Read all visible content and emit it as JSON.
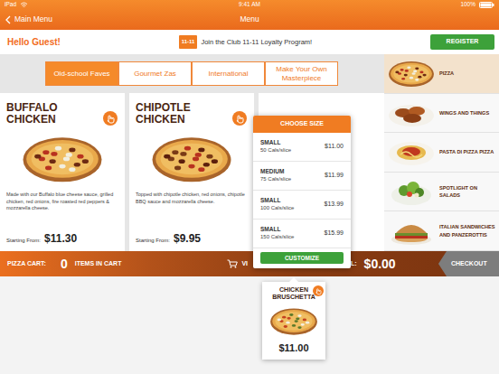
{
  "status_bar": {
    "carrier": "iPad",
    "time": "9:41 AM",
    "battery": "100%",
    "battery_level": 1
  },
  "nav_bar": {
    "back": "Main Menu",
    "title": "Menu"
  },
  "greeting": "Hello Guest!",
  "loyalty": {
    "logo": "11-11",
    "text": "Join the Club 11-11 Loyalty Program!"
  },
  "register_button": "REGISTER",
  "tabs": [
    {
      "label": "Old-school Faves",
      "selected": true
    },
    {
      "label": "Gourmet Zas",
      "selected": false
    },
    {
      "label": "International",
      "selected": false
    },
    {
      "label": "Make Your Own Masterpiece",
      "selected": false
    }
  ],
  "menu_items": [
    {
      "name": "BUFFALO CHICKEN",
      "description": "Made with our Buffalo blue cheese sauce, grilled chicken, red onions, fire roasted red peppers & mozzarella cheese.",
      "price_label": "Starting From:",
      "price": "$11.30"
    },
    {
      "name": "CHIPOTLE CHICKEN",
      "description": "Topped with chipotle chicken, red onions, chipotle BBQ sauce and mozzarella cheese.",
      "price_label": "Starting From:",
      "price": "$9.95"
    }
  ],
  "categories": [
    {
      "label": "PIZZA",
      "selected": true,
      "kind": "pizza"
    },
    {
      "label": "WINGS AND THINGS",
      "selected": false,
      "kind": "wings"
    },
    {
      "label": "PASTA DI PIZZA PIZZA",
      "selected": false,
      "kind": "pasta"
    },
    {
      "label": "SPOTLIGHT ON SALADS",
      "selected": false,
      "kind": "salad"
    },
    {
      "label": "ITALIAN SANDWICHES AND PANZEROTTIS",
      "selected": false,
      "kind": "sandwich"
    }
  ],
  "size_popup": {
    "title": "CHOOSE SIZE",
    "sizes": [
      {
        "size": "SMALL",
        "calories": "50 Cals/slice",
        "price": "$11.00"
      },
      {
        "size": "MEDIUM",
        "calories": "75 Cals/slice",
        "price": "$11.99"
      },
      {
        "size": "SMALL",
        "calories": "100 Cals/slice",
        "price": "$13.99"
      },
      {
        "size": "SMALL",
        "calories": "150 Cals/slice",
        "price": "$15.99"
      }
    ],
    "button": "CUSTOMIZE"
  },
  "cart_bar": {
    "label": "PIZZA CART:",
    "count": "0",
    "items_label": "ITEMS IN CART",
    "view_label": "VI",
    "total_label": "L:",
    "total": "$0.00",
    "checkout": "CHECKOUT"
  },
  "dragged_item": {
    "name": "CHICKEN BRUSCHETTA",
    "price": "$11.00"
  }
}
